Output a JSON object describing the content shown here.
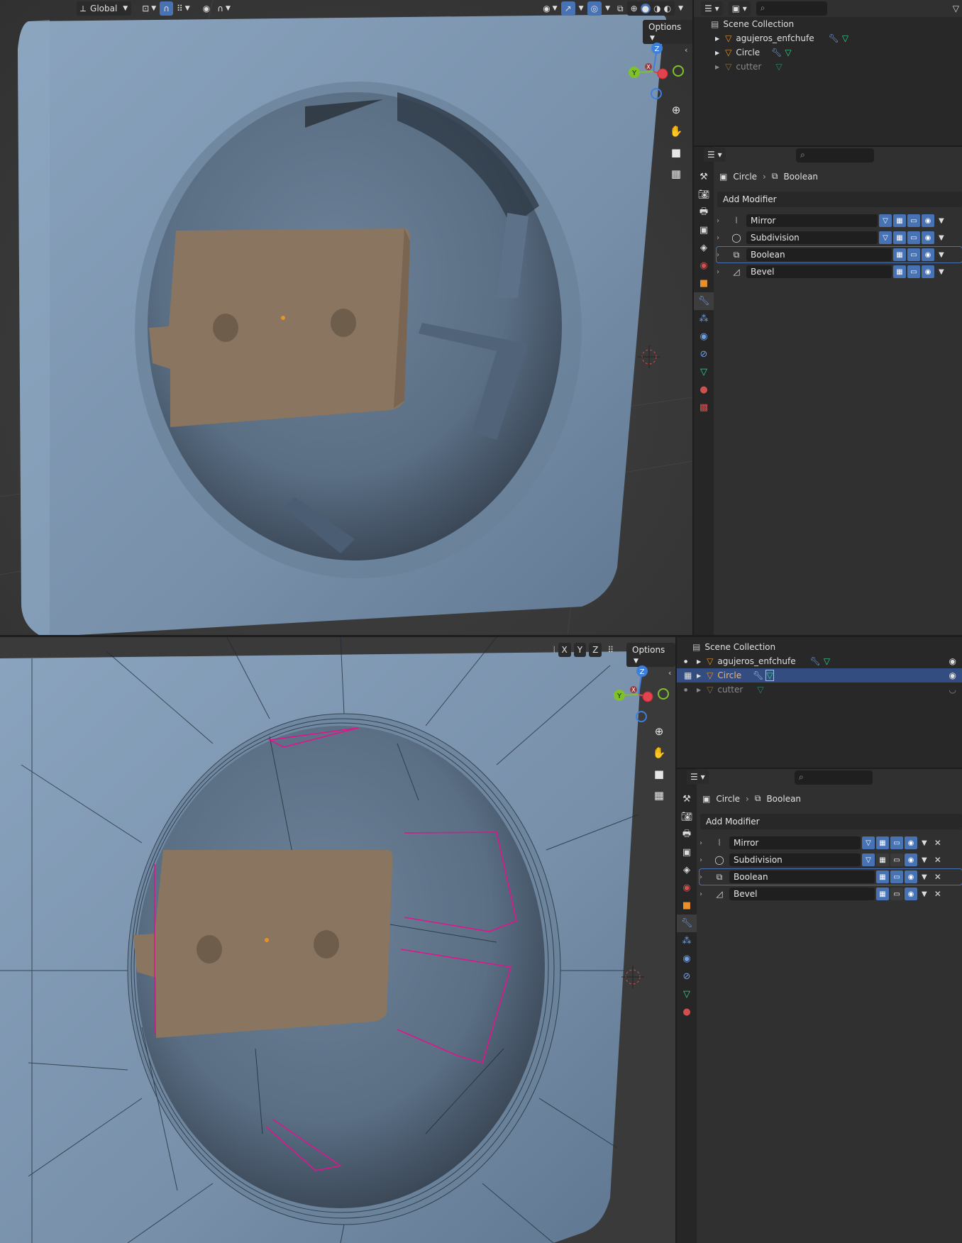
{
  "top": {
    "toolbar": {
      "transform_orientation": "Global",
      "options": "Options"
    },
    "outliner": {
      "root": "Scene Collection",
      "items": [
        {
          "name": "agujeros_enfchufe",
          "dim": false
        },
        {
          "name": "Circle",
          "dim": false
        },
        {
          "name": "cutter",
          "dim": true
        }
      ]
    },
    "properties": {
      "breadcrumb_object": "Circle",
      "breadcrumb_modifier": "Boolean",
      "add_modifier": "Add Modifier",
      "modifiers": [
        {
          "name": "Mirror",
          "icon": "mirror-icon"
        },
        {
          "name": "Subdivision",
          "icon": "subdivision-icon"
        },
        {
          "name": "Boolean",
          "icon": "boolean-icon"
        },
        {
          "name": "Bevel",
          "icon": "bevel-icon"
        }
      ]
    }
  },
  "bottom": {
    "toolbar": {
      "axis_x": "X",
      "axis_y": "Y",
      "axis_z": "Z",
      "options": "Options"
    },
    "outliner": {
      "root": "Scene Collection",
      "items": [
        {
          "name": "agujeros_enfchufe",
          "dim": false,
          "selected": false
        },
        {
          "name": "Circle",
          "dim": false,
          "selected": true
        },
        {
          "name": "cutter",
          "dim": true,
          "selected": false
        }
      ]
    },
    "properties": {
      "breadcrumb_object": "Circle",
      "breadcrumb_modifier": "Boolean",
      "add_modifier": "Add Modifier",
      "modifiers": [
        {
          "name": "Mirror",
          "icon": "mirror-icon"
        },
        {
          "name": "Subdivision",
          "icon": "subdivision-icon"
        },
        {
          "name": "Boolean",
          "icon": "boolean-icon"
        },
        {
          "name": "Bevel",
          "icon": "bevel-icon"
        }
      ]
    }
  },
  "gizmo": {
    "x": "X",
    "y": "Y",
    "z": "Z"
  },
  "colors": {
    "accent": "#4772b3",
    "mesh": "#7a93ad",
    "plate": "#8a7560",
    "seam": "#e0148c",
    "axis_x": "#e2434d",
    "axis_y": "#7fc12a",
    "axis_z": "#3c7fdc"
  }
}
